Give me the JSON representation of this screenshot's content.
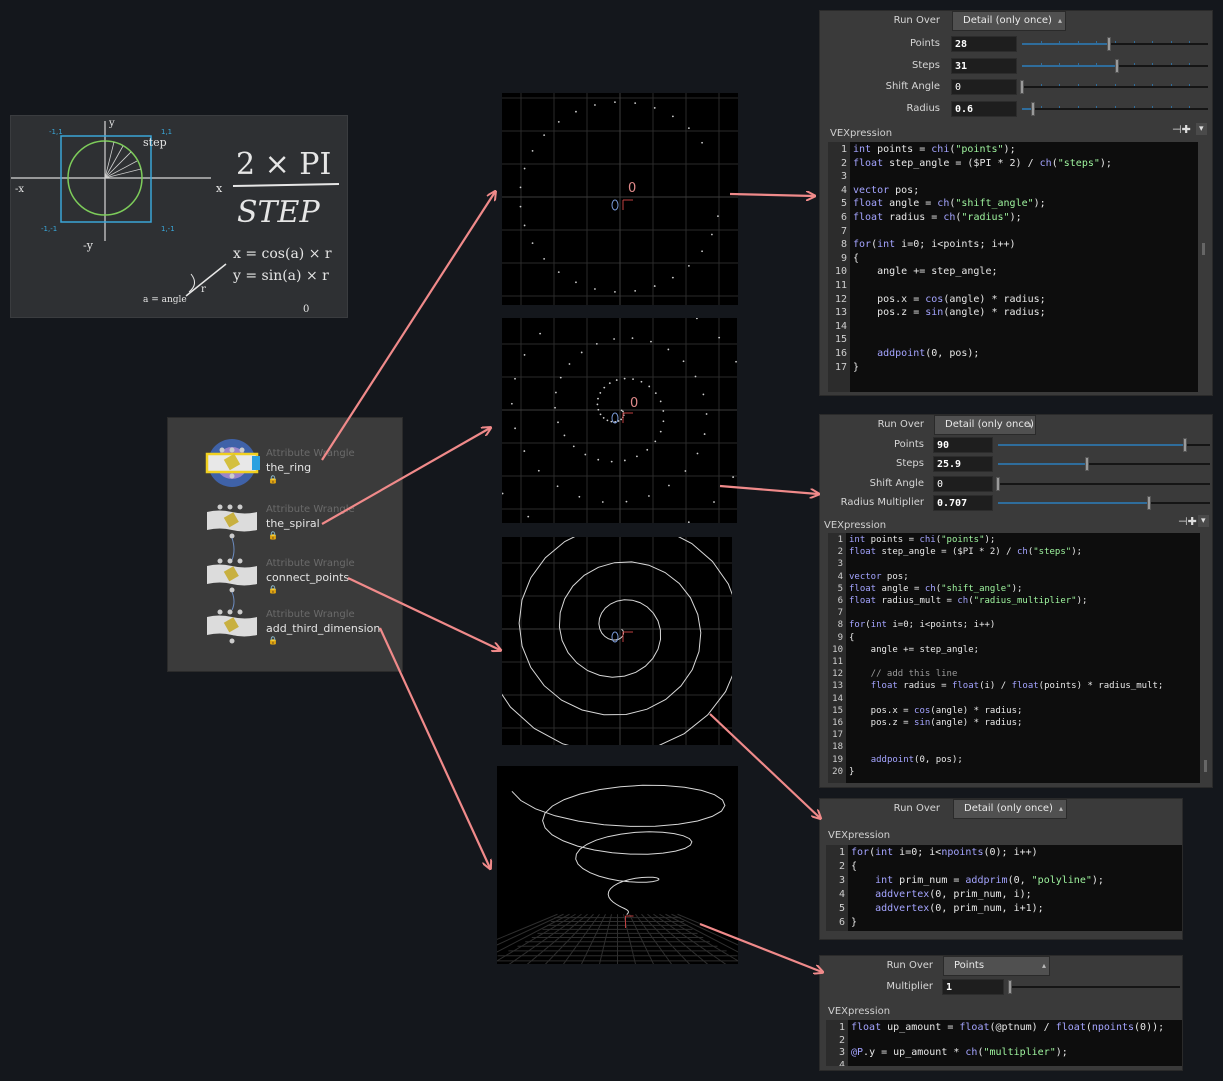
{
  "chalkboard": {
    "formula_top": "2 × PI",
    "formula_bottom": "STEP",
    "eq_x": "x = cos(a) × r",
    "eq_y": "y = sin(a) × r",
    "axis_x": "x",
    "axis_y": "y",
    "axis_neg_y": "-y",
    "axis_neg_x": "-x",
    "step_label": "step",
    "r_label": "r",
    "a_label": "a = angle",
    "origin": "0"
  },
  "nodes": [
    {
      "type": "Attribute Wrangle",
      "name": "the_ring",
      "lock": "🔒"
    },
    {
      "type": "Attribute Wrangle",
      "name": "the_spiral",
      "lock": "🔒"
    },
    {
      "type": "Attribute Wrangle",
      "name": "connect_points",
      "lock": "🔒"
    },
    {
      "type": "Attribute Wrangle",
      "name": "add_third_dimension",
      "lock": "🔒"
    }
  ],
  "viewport_origin_label": "0",
  "panels": {
    "ring": {
      "run_over_label": "Run Over",
      "run_over_value": "Detail (only once)",
      "params": [
        {
          "label": "Points",
          "value": "28",
          "level": 0.47
        },
        {
          "label": "Steps",
          "value": "31",
          "level": 0.51
        },
        {
          "label": "Shift Angle",
          "value": "0",
          "level": 0.0
        },
        {
          "label": "Radius",
          "value": "0.6",
          "level": 0.06
        }
      ],
      "vex_label": "VEXpression",
      "code": [
        "int points = chi(\"points\");",
        "float step_angle = ($PI * 2) / ch(\"steps\");",
        "",
        "vector pos;",
        "float angle = ch(\"shift_angle\");",
        "float radius = ch(\"radius\");",
        "",
        "for(int i=0; i<points; i++)",
        "{",
        "    angle += step_angle;",
        "",
        "    pos.x = cos(angle) * radius;",
        "    pos.z = sin(angle) * radius;",
        "",
        "",
        "    addpoint(0, pos);",
        "}"
      ]
    },
    "spiral": {
      "run_over_label": "Run Over",
      "run_over_value": "Detail (only once)",
      "params": [
        {
          "label": "Points",
          "value": "90",
          "level": 0.88
        },
        {
          "label": "Steps",
          "value": "25.9",
          "level": 0.42
        },
        {
          "label": "Shift Angle",
          "value": "0",
          "level": 0.0
        },
        {
          "label": "Radius Multiplier",
          "value": "0.707",
          "level": 0.71
        }
      ],
      "vex_label": "VEXpression",
      "code": [
        "int points = chi(\"points\");",
        "float step_angle = ($PI * 2) / ch(\"steps\");",
        "",
        "vector pos;",
        "float angle = ch(\"shift_angle\");",
        "float radius_mult = ch(\"radius_multiplier\");",
        "",
        "for(int i=0; i<points; i++)",
        "{",
        "    angle += step_angle;",
        "",
        "    // add this line",
        "    float radius = float(i) / float(points) * radius_mult;",
        "",
        "    pos.x = cos(angle) * radius;",
        "    pos.z = sin(angle) * radius;",
        "",
        "",
        "    addpoint(0, pos);",
        "}"
      ]
    },
    "connect": {
      "run_over_label": "Run Over",
      "run_over_value": "Detail (only once)",
      "vex_label": "VEXpression",
      "code": [
        "for(int i=0; i<npoints(0); i++)",
        "{",
        "    int prim_num = addprim(0, \"polyline\");",
        "    addvertex(0, prim_num, i);",
        "    addvertex(0, prim_num, i+1);",
        "}"
      ]
    },
    "third": {
      "run_over_label": "Run Over",
      "run_over_value": "Points",
      "params": [
        {
          "label": "Multiplier",
          "value": "1",
          "level": 0.0
        }
      ],
      "vex_label": "VEXpression",
      "code": [
        "float up_amount = float(@ptnum) / float(npoints(0));",
        "",
        "@P.y = up_amount * ch(\"multiplier\");",
        ""
      ]
    }
  },
  "colors": {
    "arrow": "#f08a8a",
    "accent_blue": "#2f6d9c",
    "node_selected": "#f0d020"
  }
}
